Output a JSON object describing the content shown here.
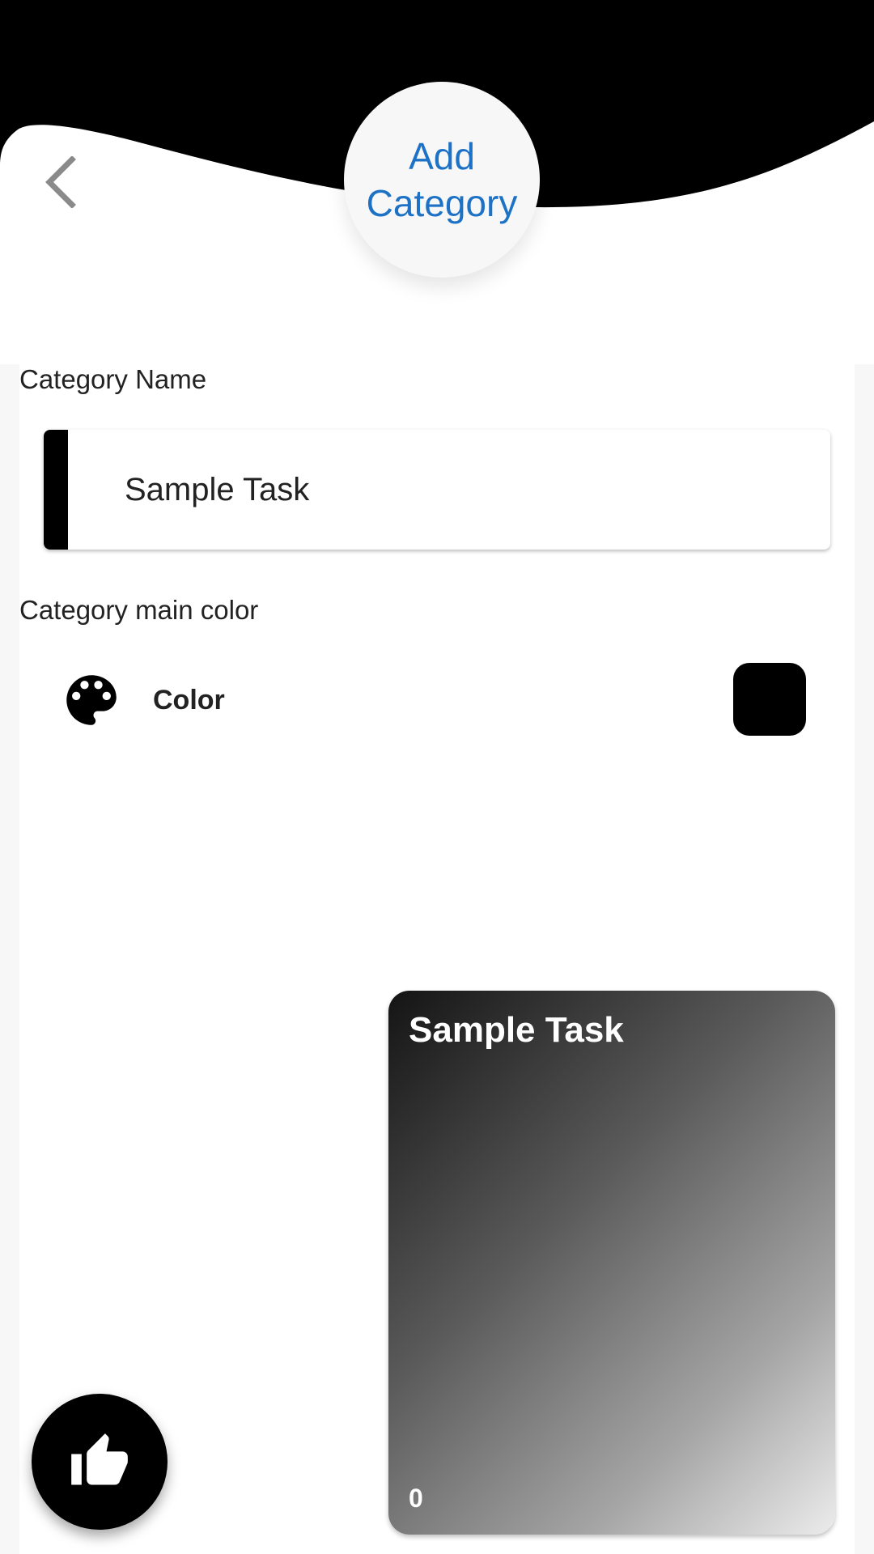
{
  "header": {
    "title": "Add Category",
    "back_icon": "chevron-left-icon"
  },
  "form": {
    "name_label": "Category Name",
    "name_value": "Sample Task",
    "color_section_label": "Category main color",
    "color_item_label": "Color",
    "color_item_icon": "palette-icon",
    "selected_color": "#000000"
  },
  "preview": {
    "title": "Sample Task",
    "count": "0"
  },
  "fab": {
    "icon": "thumb-up-icon"
  },
  "colors": {
    "accent": "#1d72c6",
    "header": "#000000",
    "background": "#ffffff"
  }
}
